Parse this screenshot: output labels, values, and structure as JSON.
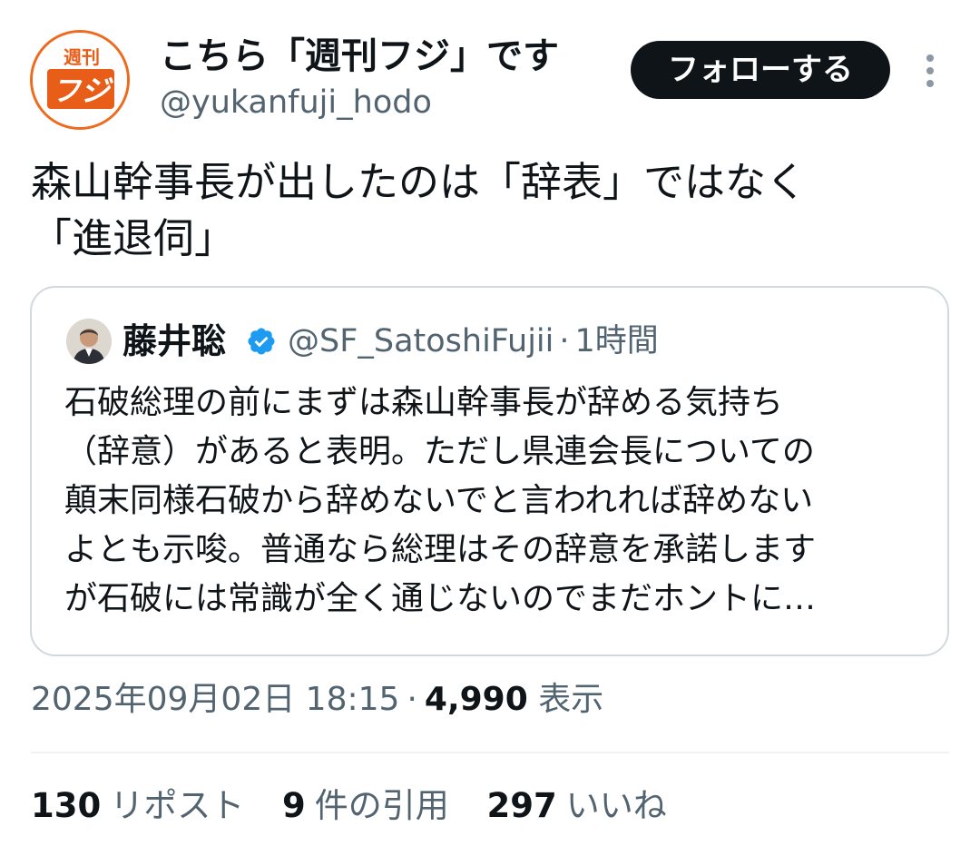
{
  "author": {
    "name": "こちら「週刊フジ」です",
    "handle": "@yukanfuji_hodo",
    "avatar_text_top": "週刊",
    "avatar_text_main": "フジ",
    "brand_color": "#ef6a1f"
  },
  "follow_button": {
    "label": "フォローする"
  },
  "more_button": {
    "icon": "more-vertical-icon"
  },
  "tweet": {
    "text": "森山幹事長が出したのは「辞表」ではなく\n「進退伺」"
  },
  "quote": {
    "name": "藤井聡",
    "verified_icon": "verified-badge-icon",
    "handle": "@SF_SatoshiFujii",
    "separator": "·",
    "time": "1時間",
    "lines": [
      "石破総理の前にまずは森山幹事長が辞める気持ち",
      "（辞意）があると表明。ただし県連会長についての",
      "顛末同様石破から辞めないでと言われれば辞めない",
      "よとも示唆。普通なら総理はその辞意を承諾します",
      "が石破には常識が全く通じないのでまだホントに…"
    ]
  },
  "meta": {
    "datetime": "2025年09月02日 18:15",
    "separator": "·",
    "views_count": "4,990",
    "views_label": "表示"
  },
  "stats": {
    "reposts_count": "130",
    "reposts_label": "リポスト",
    "quotes_count": "9",
    "quotes_label": "件の引用",
    "likes_count": "297",
    "likes_label": "いいね"
  },
  "colors": {
    "text": "#0f1419",
    "secondary": "#536471",
    "border": "#cfd9de",
    "verified": "#1d9bf0"
  }
}
